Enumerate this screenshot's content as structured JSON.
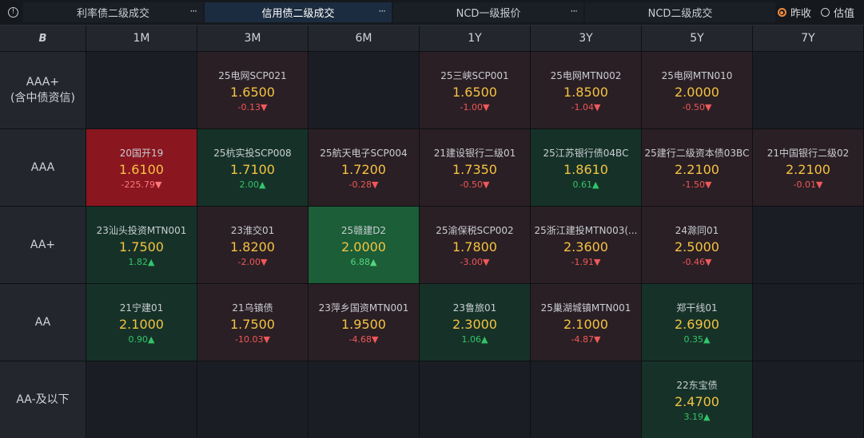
{
  "tabs": [
    {
      "label": "利率债二级成交",
      "active": false
    },
    {
      "label": "信用债二级成交",
      "active": true
    },
    {
      "label": "NCD一级报价",
      "active": false
    },
    {
      "label": "NCD二级成交",
      "active": false
    }
  ],
  "more_label": "···",
  "radios": [
    {
      "label": "昨收",
      "selected": true
    },
    {
      "label": "估值",
      "selected": false
    }
  ],
  "logo_text": "B",
  "columns": [
    "1M",
    "3M",
    "6M",
    "1Y",
    "3Y",
    "5Y",
    "7Y"
  ],
  "rows": [
    {
      "label": "AAA+\n(含中债资信)",
      "label_lines": [
        "AAA+",
        "(含中债资信)"
      ],
      "cells": [
        null,
        {
          "bond": "25电网SCP021",
          "rate": "1.6500",
          "change": "-0.13▼",
          "dir": "down",
          "tone": "red"
        },
        null,
        {
          "bond": "25三峡SCP001",
          "rate": "1.6500",
          "change": "-1.00▼",
          "dir": "down",
          "tone": "red"
        },
        {
          "bond": "25电网MTN002",
          "rate": "1.8500",
          "change": "-1.04▼",
          "dir": "down",
          "tone": "red"
        },
        {
          "bond": "25电网MTN010",
          "rate": "2.0000",
          "change": "-0.50▼",
          "dir": "down",
          "tone": "red"
        },
        null
      ]
    },
    {
      "label": "AAA",
      "label_lines": [
        "AAA"
      ],
      "cells": [
        {
          "bond": "20国开19",
          "rate": "1.6100",
          "change": "-225.79▼",
          "dir": "down",
          "tone": "bright-red"
        },
        {
          "bond": "25杭实投SCP008",
          "rate": "1.7100",
          "change": "2.00▲",
          "dir": "up",
          "tone": "green"
        },
        {
          "bond": "25航天电子SCP004",
          "rate": "1.7200",
          "change": "-0.28▼",
          "dir": "down",
          "tone": "red"
        },
        {
          "bond": "21建设银行二级01",
          "rate": "1.7350",
          "change": "-0.50▼",
          "dir": "down",
          "tone": "red"
        },
        {
          "bond": "25江苏银行债04BC",
          "rate": "1.8610",
          "change": "0.61▲",
          "dir": "up",
          "tone": "green"
        },
        {
          "bond": "25建行二级资本债03BC",
          "rate": "2.2100",
          "change": "-1.50▼",
          "dir": "down",
          "tone": "red"
        },
        {
          "bond": "21中国银行二级02",
          "rate": "2.2100",
          "change": "-0.01▼",
          "dir": "down",
          "tone": "red"
        }
      ]
    },
    {
      "label": "AA+",
      "label_lines": [
        "AA+"
      ],
      "cells": [
        {
          "bond": "23汕头投资MTN001",
          "rate": "1.7500",
          "change": "1.82▲",
          "dir": "up",
          "tone": "green"
        },
        {
          "bond": "23淮交01",
          "rate": "1.8200",
          "change": "-2.00▼",
          "dir": "down",
          "tone": "red"
        },
        {
          "bond": "25赣建D2",
          "rate": "2.0000",
          "change": "6.88▲",
          "dir": "up",
          "tone": "bright-green"
        },
        {
          "bond": "25渝保税SCP002",
          "rate": "1.7800",
          "change": "-3.00▼",
          "dir": "down",
          "tone": "red"
        },
        {
          "bond": "25浙江建投MTN003(...",
          "rate": "2.3600",
          "change": "-1.91▼",
          "dir": "down",
          "tone": "red"
        },
        {
          "bond": "24滁同01",
          "rate": "2.5000",
          "change": "-0.46▼",
          "dir": "down",
          "tone": "red"
        },
        null
      ]
    },
    {
      "label": "AA",
      "label_lines": [
        "AA"
      ],
      "cells": [
        {
          "bond": "21宁建01",
          "rate": "2.1000",
          "change": "0.90▲",
          "dir": "up",
          "tone": "green"
        },
        {
          "bond": "21乌镇债",
          "rate": "1.7500",
          "change": "-10.03▼",
          "dir": "down",
          "tone": "red"
        },
        {
          "bond": "23萍乡国资MTN001",
          "rate": "1.9500",
          "change": "-4.68▼",
          "dir": "down",
          "tone": "red"
        },
        {
          "bond": "23鲁旅01",
          "rate": "2.3000",
          "change": "1.06▲",
          "dir": "up",
          "tone": "green"
        },
        {
          "bond": "25巢湖城镇MTN001",
          "rate": "2.1000",
          "change": "-4.87▼",
          "dir": "down",
          "tone": "red"
        },
        {
          "bond": "郑干线01",
          "rate": "2.6900",
          "change": "0.35▲",
          "dir": "up",
          "tone": "green"
        },
        null
      ]
    },
    {
      "label": "AA-及以下",
      "label_lines": [
        "AA-及以下"
      ],
      "cells": [
        null,
        null,
        null,
        null,
        null,
        {
          "bond": "22东宝债",
          "rate": "2.4700",
          "change": "3.19▲",
          "dir": "up",
          "tone": "green"
        },
        null
      ]
    }
  ]
}
